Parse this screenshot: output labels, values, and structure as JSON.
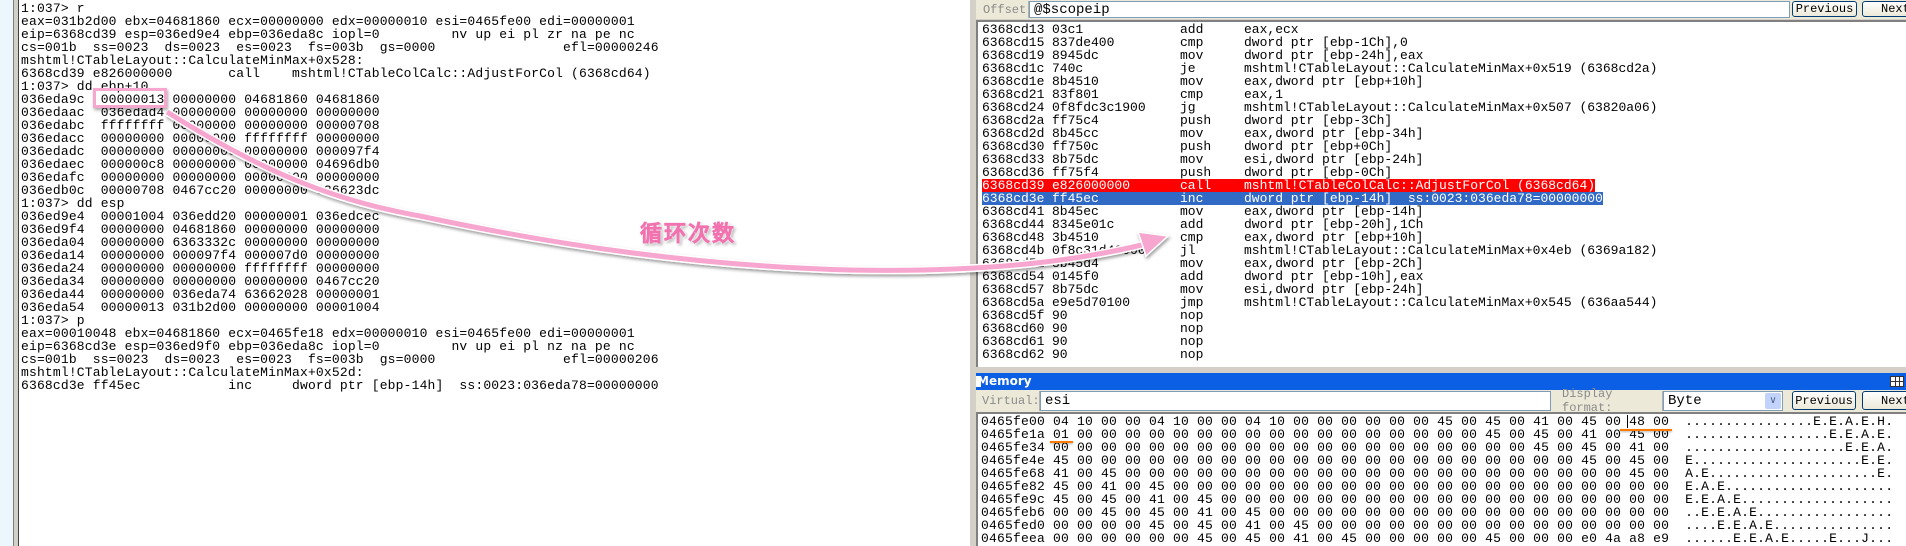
{
  "colors": {
    "breakpoint_row": "#ff0000",
    "current_row": "#316ac5",
    "annotation": "#f7a6cf",
    "underline": "#ff7a00",
    "title_bar": "#0a5fe4"
  },
  "command_window": {
    "lines": [
      "1:037> r",
      "eax=031b2d00 ebx=04681860 ecx=00000000 edx=00000010 esi=0465fe00 edi=00000001",
      "eip=6368cd39 esp=036ed9e4 ebp=036eda8c iopl=0         nv up ei pl zr na pe nc",
      "cs=001b  ss=0023  ds=0023  es=0023  fs=003b  gs=0000                efl=00000246",
      "mshtml!CTableLayout::CalculateMinMax+0x528:",
      "6368cd39 e826000000       call    mshtml!CTableColCalc::AdjustForCol (6368cd64)",
      "1:037> dd ebp+10",
      "036eda9c  00000013 00000000 04681860 04681860",
      "036edaac  036edad4 00000000 00000000 00000000",
      "036edabc  ffffffff 00000000 00000000 00000708",
      "036edacc  00000000 00000000 ffffffff 00000000",
      "036edadc  00000000 00000000 00000000 000097f4",
      "036edaec  000000c8 00000000 00000000 04696db0",
      "036edafc  00000000 00000000 00000000 00000000",
      "036edb0c  00000708 0467cc20 00000000 636623dc",
      "1:037> dd esp",
      "036ed9e4  00001004 036edd20 00000001 036edcec",
      "036ed9f4  00000000 04681860 00000000 00000000",
      "036eda04  00000000 6363332c 00000000 00000000",
      "036eda14  00000000 000097f4 000007d0 00000000",
      "036eda24  00000000 00000000 ffffffff 00000000",
      "036eda34  00000000 00000000 00000000 0467cc20",
      "036eda44  00000000 036eda74 63662028 00000001",
      "036eda54  00000013 031b2d00 00000000 00001004",
      "1:037> p",
      "eax=00010048 ebx=04681860 ecx=0465fe18 edx=00000010 esi=0465fe00 edi=00000001",
      "eip=6368cd3e esp=036ed9f0 ebp=036eda8c iopl=0         nv up ei pl nz na pe nc",
      "cs=001b  ss=0023  ds=0023  es=0023  fs=003b  gs=0000                efl=00000206",
      "mshtml!CTableLayout::CalculateMinMax+0x52d:",
      "6368cd3e ff45ec           inc     dword ptr [ebp-14h]  ss:0023:036eda78=00000000"
    ]
  },
  "annotation": {
    "label": "循环次数"
  },
  "disassembly": {
    "offset_label": "Offset:",
    "offset_value": "@$scopeip",
    "previous_label": "Previous",
    "next_label": "Next",
    "breakpoint_index": 12,
    "current_index": 13,
    "rows": [
      [
        "6368cd13",
        "03c1",
        "add",
        "eax,ecx"
      ],
      [
        "6368cd15",
        "837de400",
        "cmp",
        "dword ptr [ebp-1Ch],0"
      ],
      [
        "6368cd19",
        "8945dc",
        "mov",
        "dword ptr [ebp-24h],eax"
      ],
      [
        "6368cd1c",
        "740c",
        "je",
        "mshtml!CTableLayout::CalculateMinMax+0x519 (6368cd2a)"
      ],
      [
        "6368cd1e",
        "8b4510",
        "mov",
        "eax,dword ptr [ebp+10h]"
      ],
      [
        "6368cd21",
        "83f801",
        "cmp",
        "eax,1"
      ],
      [
        "6368cd24",
        "0f8fdc3c1900",
        "jg",
        "mshtml!CTableLayout::CalculateMinMax+0x507 (63820a06)"
      ],
      [
        "6368cd2a",
        "ff75c4",
        "push",
        "dword ptr [ebp-3Ch]"
      ],
      [
        "6368cd2d",
        "8b45cc",
        "mov",
        "eax,dword ptr [ebp-34h]"
      ],
      [
        "6368cd30",
        "ff750c",
        "push",
        "dword ptr [ebp+0Ch]"
      ],
      [
        "6368cd33",
        "8b75dc",
        "mov",
        "esi,dword ptr [ebp-24h]"
      ],
      [
        "6368cd36",
        "ff75f4",
        "push",
        "dword ptr [ebp-0Ch]"
      ],
      [
        "6368cd39",
        "e826000000",
        "call",
        "mshtml!CTableColCalc::AdjustForCol (6368cd64)"
      ],
      [
        "6368cd3e",
        "ff45ec",
        "inc",
        "dword ptr [ebp-14h]  ss:0023:036eda78=00000000"
      ],
      [
        "6368cd41",
        "8b45ec",
        "mov",
        "eax,dword ptr [ebp-14h]"
      ],
      [
        "6368cd44",
        "8345e01c",
        "add",
        "dword ptr [ebp-20h],1Ch"
      ],
      [
        "6368cd48",
        "3b4510",
        "cmp",
        "eax,dword ptr [ebp+10h]"
      ],
      [
        "6368cd4b",
        "0f8c31d40000",
        "jl",
        "mshtml!CTableLayout::CalculateMinMax+0x4eb (6369a182)"
      ],
      [
        "6368cd51",
        "8b45d4",
        "mov",
        "eax,dword ptr [ebp-2Ch]"
      ],
      [
        "6368cd54",
        "0145f0",
        "add",
        "dword ptr [ebp-10h],eax"
      ],
      [
        "6368cd57",
        "8b75dc",
        "mov",
        "esi,dword ptr [ebp-24h]"
      ],
      [
        "6368cd5a",
        "e9e5d70100",
        "jmp",
        "mshtml!CTableLayout::CalculateMinMax+0x545 (636aa544)"
      ],
      [
        "6368cd5f",
        "90",
        "nop",
        ""
      ],
      [
        "6368cd60",
        "90",
        "nop",
        ""
      ],
      [
        "6368cd61",
        "90",
        "nop",
        ""
      ],
      [
        "6368cd62",
        "90",
        "nop",
        ""
      ]
    ]
  },
  "memory": {
    "title": "Memory",
    "virtual_label": "Virtual:",
    "virtual_value": "esi",
    "display_format_label": "Display format:",
    "display_format_value": "Byte",
    "previous_label": "Previous",
    "next_label": "Next",
    "rows": [
      [
        "0465fe00",
        "04 10 00 00 04 10 00 00 04 10 00 00 00 00 00 00 45 00 45 00 41 00 45 00 48 00",
        "................E.E.A.E.H."
      ],
      [
        "0465fe1a",
        "01 00 00 00 00 00 00 00 00 00 00 00 00 00 00 00 00 00 45 00 45 00 41 00 45 00",
        "..................E.E.A.E."
      ],
      [
        "0465fe34",
        "00 00 00 00 00 00 00 00 00 00 00 00 00 00 00 00 00 00 00 00 45 00 45 00 41 00",
        "....................E.E.A."
      ],
      [
        "0465fe4e",
        "45 00 00 00 00 00 00 00 00 00 00 00 00 00 00 00 00 00 00 00 00 00 45 00 45 00",
        "E.....................E.E."
      ],
      [
        "0465fe68",
        "41 00 45 00 00 00 00 00 00 00 00 00 00 00 00 00 00 00 00 00 00 00 00 00 45 00",
        "A.E.....................E."
      ],
      [
        "0465fe82",
        "45 00 41 00 45 00 00 00 00 00 00 00 00 00 00 00 00 00 00 00 00 00 00 00 00 00",
        "E.A.E....................."
      ],
      [
        "0465fe9c",
        "45 00 45 00 41 00 45 00 00 00 00 00 00 00 00 00 00 00 00 00 00 00 00 00 00 00",
        "E.E.A.E..................."
      ],
      [
        "0465feb6",
        "00 00 45 00 45 00 41 00 45 00 00 00 00 00 00 00 00 00 00 00 00 00 00 00 00 00",
        "..E.E.A.E................."
      ],
      [
        "0465fed0",
        "00 00 00 00 45 00 45 00 41 00 45 00 00 00 00 00 00 00 00 00 00 00 00 00 00 00",
        "....E.E.A.E..............."
      ],
      [
        "0465feea",
        "00 00 00 00 00 00 45 00 45 00 41 00 45 00 00 00 00 00 45 00 00 00 e0 4a a8 e9",
        "......E.E.A.E.....E...J..."
      ]
    ]
  }
}
